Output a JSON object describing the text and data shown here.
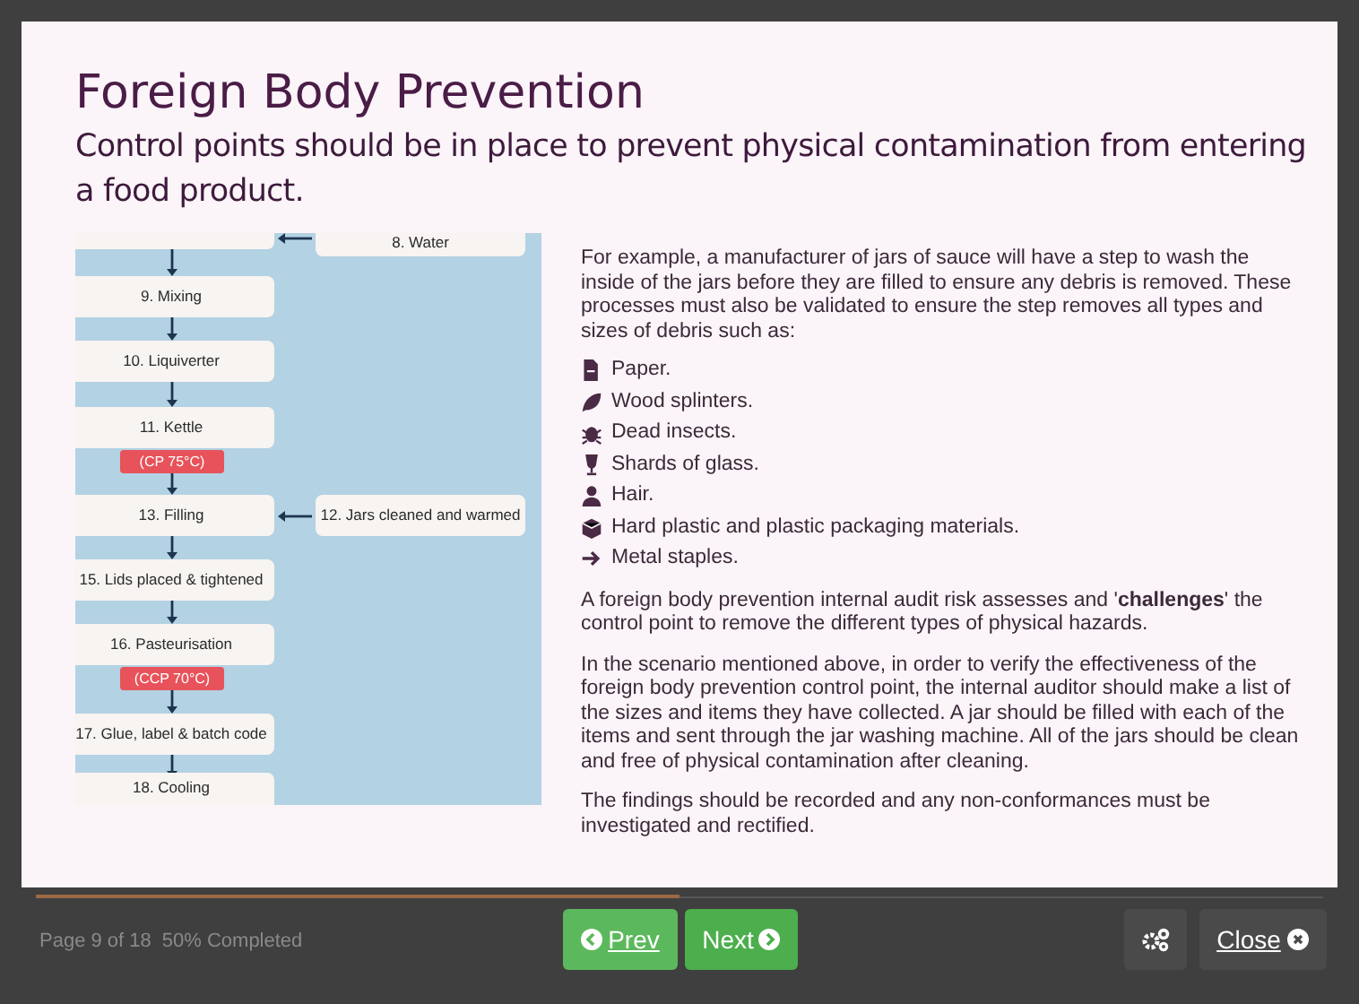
{
  "title": "Foreign Body Prevention",
  "subtitle": "Control points should be in place to prevent physical contamination from entering a food product.",
  "flowchart": {
    "top_input": "8. Water",
    "steps": [
      {
        "label": "9. Mixing"
      },
      {
        "label": "10. Liquiverter"
      },
      {
        "label": "11. Kettle",
        "badge": "(CP 75°C)"
      },
      {
        "label": "13. Filling",
        "input": "12. Jars cleaned and warmed"
      },
      {
        "label": "15. Lids placed & tightened"
      },
      {
        "label": "16. Pasteurisation",
        "badge": "(CCP 70°C)"
      },
      {
        "label": "17. Glue, label & batch code"
      },
      {
        "label": "18. Cooling"
      }
    ]
  },
  "intro": "For example, a manufacturer of jars of sauce will have a step to wash the inside of the jars before they are filled to ensure any debris is removed. These processes must also be validated to ensure the step removes all types and sizes of debris such as:",
  "hazards": [
    {
      "kind": "file",
      "text": "Paper."
    },
    {
      "kind": "leaf",
      "text": "Wood splinters."
    },
    {
      "kind": "bug",
      "text": "Dead insects."
    },
    {
      "kind": "glass",
      "text": "Shards of glass."
    },
    {
      "kind": "user",
      "text": "Hair."
    },
    {
      "kind": "box",
      "text": "Hard plastic and plastic packaging materials."
    },
    {
      "kind": "arrow",
      "text": "Metal staples."
    }
  ],
  "paragraphs": [
    "A foreign body prevention internal audit risk assesses and '**challenges**' the control point to remove the different types of physical hazards.",
    "In the scenario mentioned above, in order to verify the effectiveness of the foreign body prevention control point, the internal auditor should make a list of the sizes and items they have collected. A jar should be filled with each of the items and sent through the jar washing machine. All of the jars should be clean and free of physical contamination after cleaning.",
    "The findings should be recorded and any non-conformances must be investigated and rectified."
  ],
  "progress": {
    "level": 0.5
  },
  "footer": {
    "page": "Page 9 of 18",
    "completed": "50% Completed",
    "prev": "Prev",
    "next": "Next",
    "close": "Close"
  }
}
